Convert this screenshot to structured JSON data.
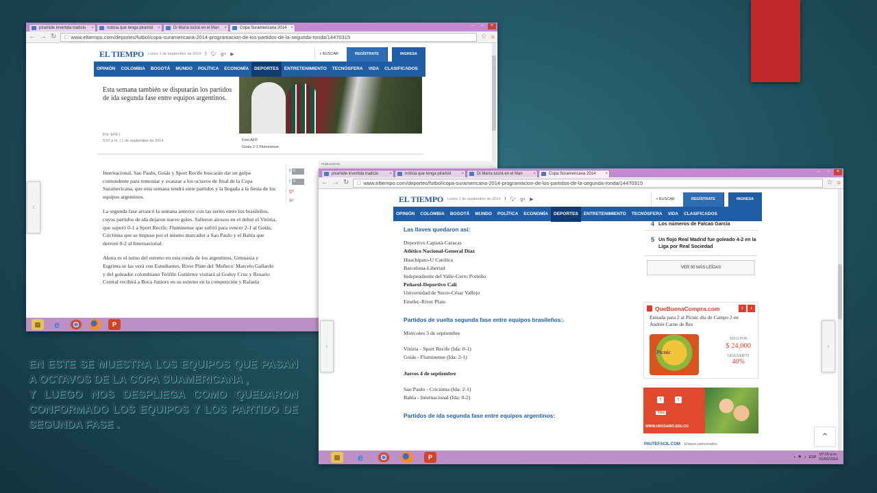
{
  "slide": {
    "caption_lines": [
      "EN ESTE SE MUESTRA LOS EQUIPOS QUE PASAN A OCTAVOS DE LA COPA SUAMERICANA ,",
      "Y LUEGO NOS DESPLIEGA COMO QUEDARON CONFORMADO LOS EQUIPOS Y LOS PARTIDO DE SEGUNDA FASE ."
    ],
    "accent_color": "#c0282c"
  },
  "browser": {
    "tabs": [
      "piramide invertida tradicio",
      "noticia que tenga piramid",
      "Di María lucirá en el Man",
      "Copa Suramericana 2014"
    ],
    "url": "www.eltiempo.com/deportes/futbol/copa-suramericana-2014-programacion-de-los-partidos-de-la-segunda-ronda/14470315"
  },
  "site": {
    "logo": "EL TIEMPO",
    "date": "Lunes 1 de septiembre de 2014",
    "search": "BUSCAR",
    "register": "REGÍSTRATE",
    "login": "INGRESA",
    "nav": [
      "OPINIÓN",
      "COLOMBIA",
      "BOGOTÁ",
      "MUNDO",
      "POLÍTICA",
      "ECONOMÍA",
      "DEPORTES",
      "ENTRETENIMIENTO",
      "TECNÓSFERA",
      "VIDA",
      "CLASIFICADOS"
    ],
    "nav_active": "DEPORTES",
    "brand_color": "#1f5da6"
  },
  "shot1": {
    "lead": "Esta semana también se disputarán los partidos de ida segunda fase entre equipos argentinos.",
    "byline": "Por: EFE |",
    "time": "5:57 p.m. | 1 de septiembre de 2014",
    "photo_credit": "Foto AFP",
    "photo_caption": "Goiás 2-1 Fluminense.",
    "advert_label": "PUBLICIDAD",
    "share_count": "0",
    "paragraphs": [
      "Internacional, Sao Paulo, Goiás y Sport Recife buscarán dar un golpe contundente para remontar y avanzar a los octavos de final de la Copa Suramericana, que esta semana tendrá siete partidos y la llegada a la fiesta de los equipos argentinos.",
      "La segunda fase arrancó la semana anterior con las series entre los brasileños, cuyos partidos de ida dejaron nueve goles. Salieron airosos en el debut el Vitória, que superó 0-1 a Sport Recife; Fluminense que sufrió para vencer 2-1 al Goiás; Criciúma que se impuso por el mismo marcador a Sao Paulo y el Bahía que derrotó 0-2 al Internacional.",
      "Ahora es el turno del estreno en esta ronda de los argentinos. Gimnasia y Esgrima se las verá con Estudiantes, River Plate del 'Muñeco' Marcelo Gallardo y del goleador colombiano Teófilo Gutiérrez visitará al Godoy Cruz y Rosario Central recibirá a Boca Juniors en su estreno en la competición y Rafaela"
    ]
  },
  "shot2": {
    "article": {
      "heading_keys": "Las llaves quedaron así:",
      "keys": [
        {
          "text": "Deportivo Capiatá-Caracas",
          "bold": false
        },
        {
          "text": "Atlético Nacional-General Díaz",
          "bold": true
        },
        {
          "text": "Huachipato-U Católica",
          "bold": false
        },
        {
          "text": "Barcelona-Libertad",
          "bold": false
        },
        {
          "text": "Independiente del Valle-Cerro Porteño",
          "bold": false
        },
        {
          "text": "Peñarol-Deportivo Cali",
          "bold": true
        },
        {
          "text": "Universidad de Sucre-César Vallejo",
          "bold": false
        },
        {
          "text": "Emelec-River Plate.",
          "bold": false
        }
      ],
      "heading_return": "Partidos de vuelta segunda fase entre equipos brasileños:.",
      "day1": "Miércoles 3 de septiembre",
      "day1_matches": [
        "Vitória - Sport Recife (Ida: 0-1)",
        "Goiás - Fluminense (Ida: 2-1)"
      ],
      "day2": "Jueves 4 de septiembre",
      "day2_matches": [
        "Sao Paulo - Criciúma (Ida: 2-1)",
        "Bahía - Internacional (Ida: 0-2)"
      ],
      "heading_first_leg": "Partidos de ida segunda fase entre equipos argentinos:"
    },
    "most_read": [
      {
        "n": "4",
        "title": "Los números de Falcao García"
      },
      {
        "n": "5",
        "title": "Un flojo Real Madrid fue goleado 4-2 en la Liga por Real Sociedad"
      }
    ],
    "more_read_btn": "VER 50 MÁS LEÍDAS",
    "qbc": {
      "brand": "QueBuenaCompra.com",
      "title": "Entrada para 2 al Pícnic día de Campo 2 en Andrés Carne de Res",
      "img_logo": "Pícnic",
      "price_label": "SOLO POR",
      "price": "$ 24,000",
      "discount_label": "DESCUENTO",
      "discount": "40%"
    },
    "urosario": {
      "link": "WWW.UROSARIO.EDU.CO",
      "youtube": "You"
    },
    "pautefacil": "PAUTEFACIL.COM",
    "pautefacil_sub": "Enlaces patrocinados",
    "tray_lang": "ESP",
    "clock_time": "07:15 p.m.",
    "clock_date": "01/09/2014"
  },
  "taskbar_icons": [
    "file-explorer-icon",
    "internet-explorer-icon",
    "chrome-icon",
    "firefox-icon",
    "powerpoint-icon"
  ]
}
